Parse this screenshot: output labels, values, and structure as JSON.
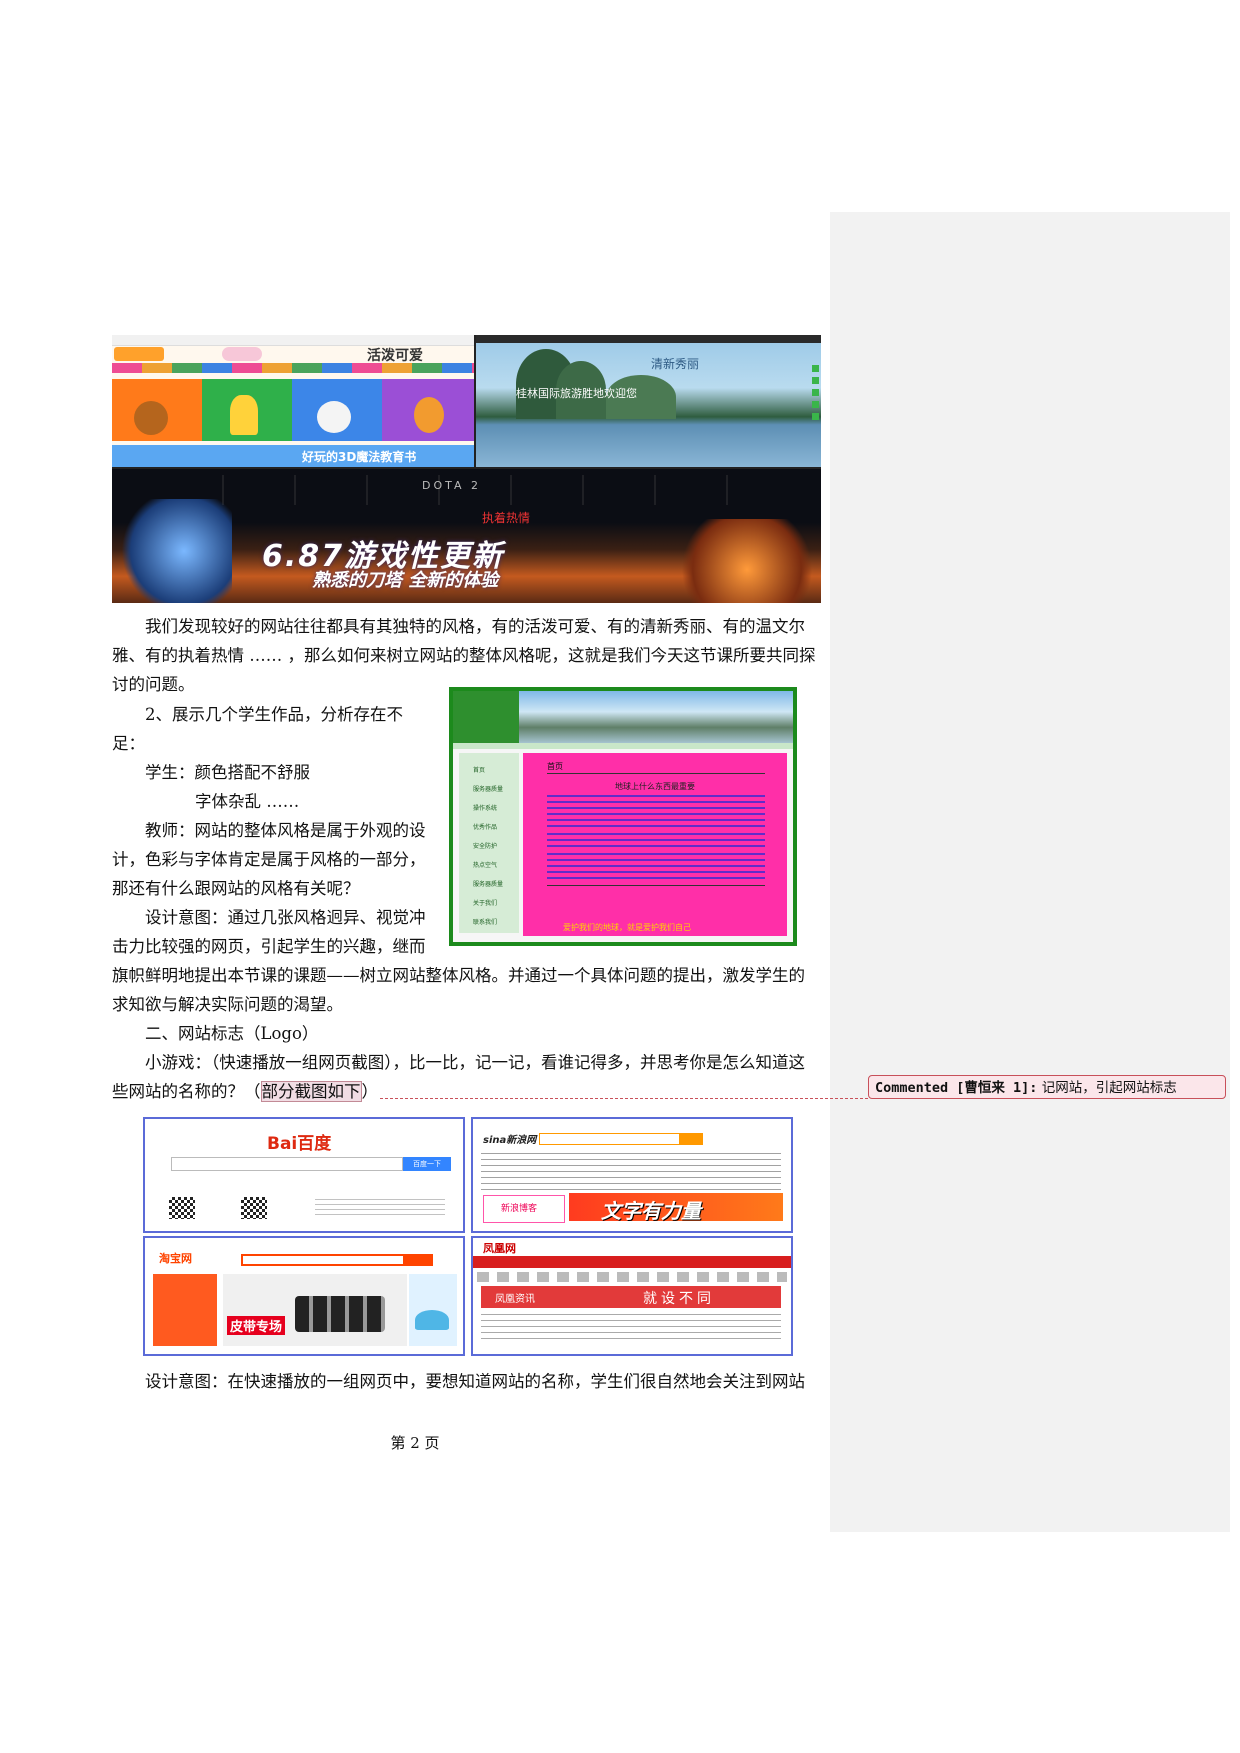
{
  "hero_image": {
    "panel1_title": "活泼可爱",
    "panel1_banner": "好玩的3D魔法教育书",
    "panel2_title": "清新秀丽",
    "panel2_caption": "桂林国际旅游胜地欢迎您",
    "panel3_logo": "DOTA 2",
    "panel3_subtitle": "执着热情",
    "panel3_headline": "6.87游戏性更新",
    "panel3_tagline": "熟悉的刀塔 全新的体验"
  },
  "paragraph1": "我们发现较好的网站往往都具有其独特的风格，有的活泼可爱、有的清新秀丽、有的温文尔雅、有的执着热情 …… ，那么如何来树立网站的整体风格呢，这就是我们今天这节课所要共同探讨的问题。",
  "item2": {
    "line1": "2、展示几个学生作品，分析存在不",
    "line2": "足：",
    "student_label": "学生：颜色搭配不舒服",
    "student_point2": "字体杂乱 ……",
    "teacher_line1": "教师：网站的整体风格是属于外观的设",
    "teacher_line2": "计，色彩与字体肯定是属于风格的一部分，",
    "teacher_line3": "那还有什么跟网站的风格有关呢？",
    "design_line1": "设计意图：通过几张风格迥异、视觉冲",
    "design_line2": "击力比较强的网页，引起学生的兴趣，继而",
    "design_rest": "旗帜鲜明地提出本节课的课题——树立网站整体风格。并通过一个具体问题的提出，激发学生的求知欲与解决实际问题的渴望。"
  },
  "student_work": {
    "nav_items": [
      "首页",
      "服务器质量",
      "操作系统",
      "优秀作品",
      "安全防护",
      "热点空气",
      "服务器质量",
      "关于我们",
      "联系我们"
    ],
    "content_title": "首页",
    "content_heading": "地球上什么东西最重要",
    "footer_text": "爱护我们的地球，就是爱护我们自己"
  },
  "section2_heading": "二、网站标志（Logo）",
  "game_text_1": "小游戏：（快速播放一组网页截图），比一比，记一记，看谁记得多，并思考你是怎么知道这些网站的名称的？（",
  "game_highlight": "部分截图如下",
  "game_text_2": "）",
  "comment": {
    "label": "Commented [曹恒来 1]:",
    "text": "记网站，引起网站标志"
  },
  "screenshots": {
    "baidu_logo": "Bai百度",
    "baidu_button": "百度一下",
    "sina_logo": "sina新浪网",
    "sina_banner": "文字有力量",
    "sina_blog": "新浪博客",
    "taobao_logo": "淘宝网",
    "taobao_promo": "皮带专场",
    "ifeng_logo": "凤凰网",
    "ifeng_banner": "就设不同",
    "ifeng_news": "凤凰资讯"
  },
  "design_intent_last": "设计意图：在快速播放的一组网页中，要想知道网站的名称，学生们很自然地会关注到网站",
  "page_number": "第 2 页",
  "colors": {
    "frame_blue": "#5b6bd8",
    "comment_border": "#c8505a",
    "student_pink": "#ff2fa8",
    "student_green": "#1c8a1c"
  }
}
